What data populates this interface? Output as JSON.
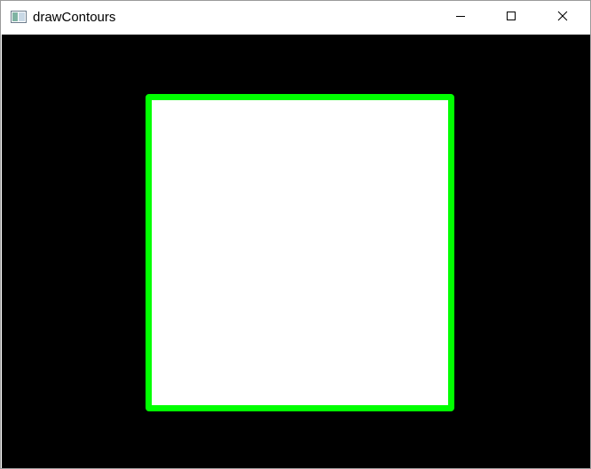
{
  "window": {
    "title": "drawContours",
    "controls": {
      "minimize_icon": "minimize-icon",
      "maximize_icon": "maximize-icon",
      "close_icon": "close-icon"
    }
  },
  "canvas": {
    "background_color": "#000000",
    "shape": {
      "type": "rectangle-contour",
      "fill_color": "#ffffff",
      "contour_color": "#00ff00"
    }
  }
}
